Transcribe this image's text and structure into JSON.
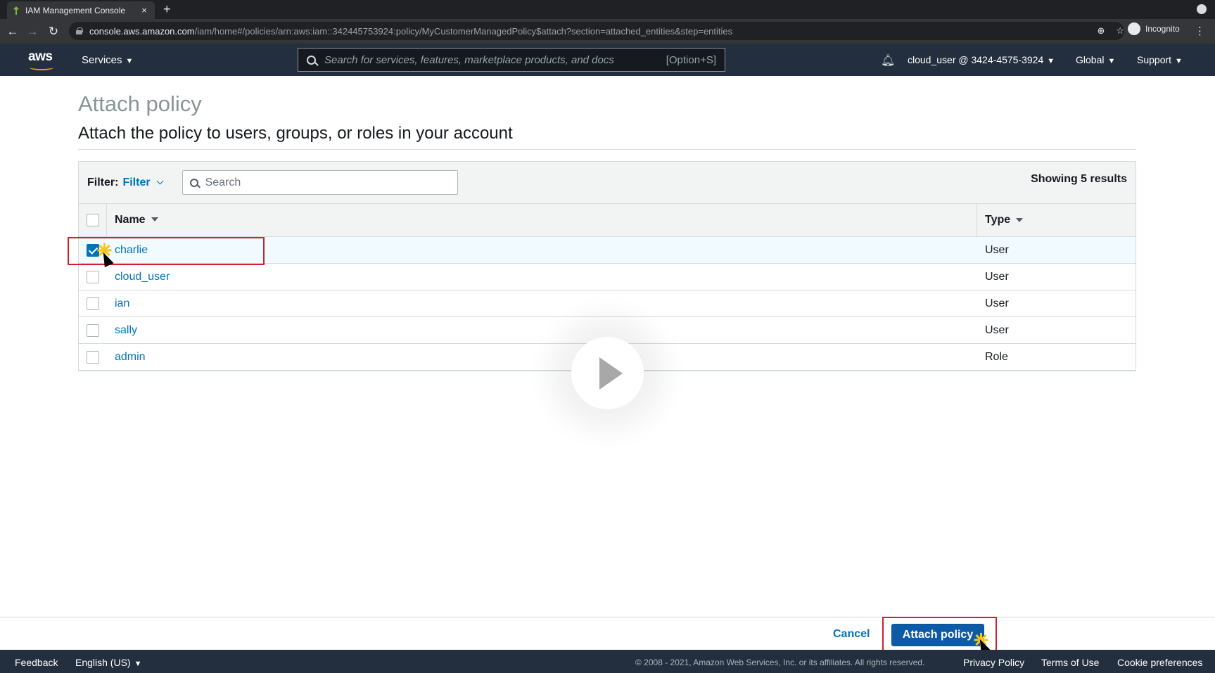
{
  "browser": {
    "tab_title": "IAM Management Console",
    "tab_close": "×",
    "new_tab": "+",
    "url_domain": "console.aws.amazon.com",
    "url_path": "/iam/home#/policies/arn:aws:iam::342445753924:policy/MyCustomerManagedPolicy$attach?section=attached_entities&step=entities",
    "profile_label": "Incognito"
  },
  "aws_nav": {
    "logo_text": "aws",
    "services_label": "Services",
    "search_placeholder": "Search for services, features, marketplace products, and docs",
    "search_shortcut": "[Option+S]",
    "account_label": "cloud_user @ 3424-4575-3924",
    "region_label": "Global",
    "support_label": "Support"
  },
  "page": {
    "title": "Attach policy",
    "subtitle": "Attach the policy to users, groups, or roles in your account"
  },
  "filter": {
    "label": "Filter:",
    "link": "Filter",
    "search_placeholder": "Search",
    "results": "Showing 5 results"
  },
  "table": {
    "columns": {
      "name": "Name",
      "type": "Type"
    },
    "rows": [
      {
        "name": "charlie",
        "type": "User",
        "checked": true
      },
      {
        "name": "cloud_user",
        "type": "User",
        "checked": false
      },
      {
        "name": "ian",
        "type": "User",
        "checked": false
      },
      {
        "name": "sally",
        "type": "User",
        "checked": false
      },
      {
        "name": "admin",
        "type": "Role",
        "checked": false
      }
    ]
  },
  "actions": {
    "cancel": "Cancel",
    "attach": "Attach policy"
  },
  "footer": {
    "feedback": "Feedback",
    "language": "English (US)",
    "copyright": "© 2008 - 2021, Amazon Web Services, Inc. or its affiliates. All rights reserved.",
    "privacy": "Privacy Policy",
    "terms": "Terms of Use",
    "cookies": "Cookie preferences"
  },
  "colors": {
    "aws_nav_bg": "#232f3e",
    "link_blue": "#0073bb",
    "primary_button": "#0d5aa7",
    "highlight_red": "#d0202b",
    "aws_orange": "#ff9900"
  }
}
